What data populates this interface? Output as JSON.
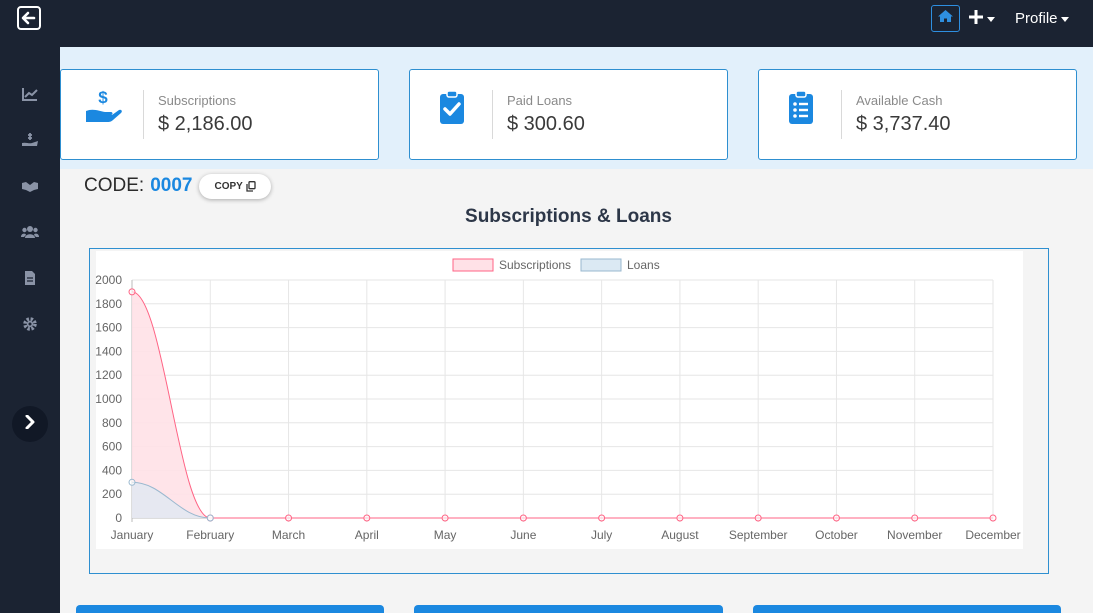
{
  "topbar": {
    "profile_label": "Profile",
    "icons": [
      "back-arrow-icon",
      "home-icon",
      "plus-icon",
      "caret-down-icon"
    ],
    "accent": "#2e8fe0"
  },
  "sidebar": {
    "icons": [
      "chart-line-icon",
      "hand-dollar-icon",
      "handshake-icon",
      "users-icon",
      "file-icon",
      "gear-icon",
      "chevron-right-icon"
    ]
  },
  "cards": [
    {
      "label": "Subscriptions",
      "value": "$ 2,186.00",
      "icon": "hand-holding-dollar-icon"
    },
    {
      "label": "Paid Loans",
      "value": "$ 300.60",
      "icon": "clipboard-check-icon"
    },
    {
      "label": "Available Cash",
      "value": "$ 3,737.40",
      "icon": "clipboard-list-icon"
    }
  ],
  "code": {
    "label": "CODE:",
    "value": "0007",
    "copy_label": "COPY"
  },
  "chart_title": "Subscriptions & Loans",
  "chart_data": {
    "type": "area",
    "title": "Subscriptions & Loans",
    "categories": [
      "January",
      "February",
      "March",
      "April",
      "May",
      "June",
      "July",
      "August",
      "September",
      "October",
      "November",
      "December"
    ],
    "series": [
      {
        "name": "Subscriptions",
        "values": [
          1900,
          0,
          0,
          0,
          0,
          0,
          0,
          0,
          0,
          0,
          0,
          0
        ],
        "color": "#ff6384",
        "fill": "#ffe1e7"
      },
      {
        "name": "Loans",
        "values": [
          300,
          0,
          null,
          null,
          null,
          null,
          null,
          null,
          null,
          null,
          null,
          null
        ],
        "color": "#9ab8cf",
        "fill": "#dbe9f3"
      }
    ],
    "yticks": [
      0,
      200,
      400,
      600,
      800,
      1000,
      1200,
      1400,
      1600,
      1800,
      2000
    ],
    "ylim": [
      0,
      2000
    ],
    "grid": true,
    "legend": "top"
  },
  "colors": {
    "primary": "#1b88e0",
    "sidebar": "#1b2332",
    "card_border": "#2e8fd0"
  }
}
